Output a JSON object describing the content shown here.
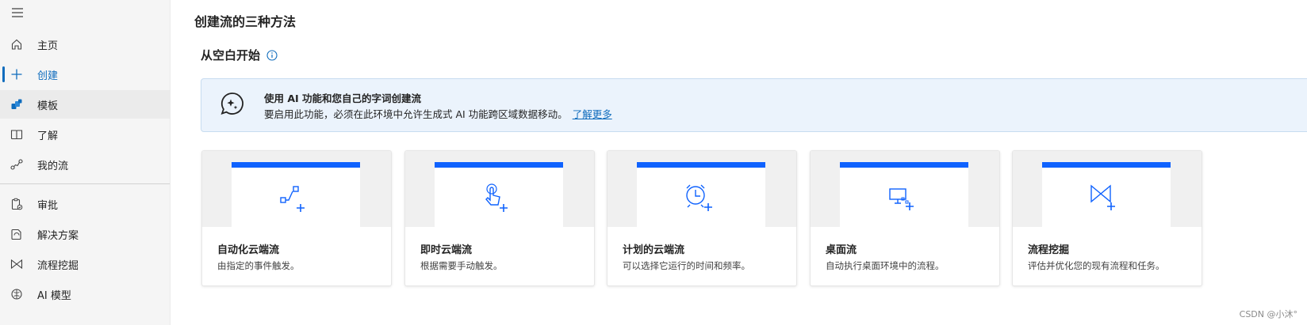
{
  "sidebar": {
    "items": [
      {
        "label": "主页",
        "icon": "home-icon"
      },
      {
        "label": "创建",
        "icon": "plus-icon"
      },
      {
        "label": "模板",
        "icon": "template-icon"
      },
      {
        "label": "了解",
        "icon": "book-icon"
      },
      {
        "label": "我的流",
        "icon": "flow-icon"
      },
      {
        "label": "审批",
        "icon": "approval-icon"
      },
      {
        "label": "解决方案",
        "icon": "solution-icon"
      },
      {
        "label": "流程挖掘",
        "icon": "process-mining-icon"
      },
      {
        "label": "AI 模型",
        "icon": "ai-model-icon"
      }
    ]
  },
  "main": {
    "title": "创建流的三种方法",
    "section_title": "从空白开始"
  },
  "banner": {
    "title": "使用 AI 功能和您自己的字词创建流",
    "text": "要启用此功能，必须在此环境中允许生成式 AI 功能跨区域数据移动。",
    "link": "了解更多"
  },
  "cards": [
    {
      "title": "自动化云端流",
      "desc": "由指定的事件触发。",
      "icon": "automated-flow-icon"
    },
    {
      "title": "即时云端流",
      "desc": "根据需要手动触发。",
      "icon": "instant-flow-icon"
    },
    {
      "title": "计划的云端流",
      "desc": "可以选择它运行的时间和频率。",
      "icon": "scheduled-flow-icon"
    },
    {
      "title": "桌面流",
      "desc": "自动执行桌面环境中的流程。",
      "icon": "desktop-flow-icon"
    },
    {
      "title": "流程挖掘",
      "desc": "评估并优化您的现有流程和任务。",
      "icon": "process-mining-icon"
    }
  ],
  "watermark": "CSDN @小沐°",
  "colors": {
    "accent": "#0f6cbd",
    "card_bar": "#0f62fe",
    "banner_bg": "#ebf3fc",
    "sidebar_bg": "#f5f5f5"
  }
}
